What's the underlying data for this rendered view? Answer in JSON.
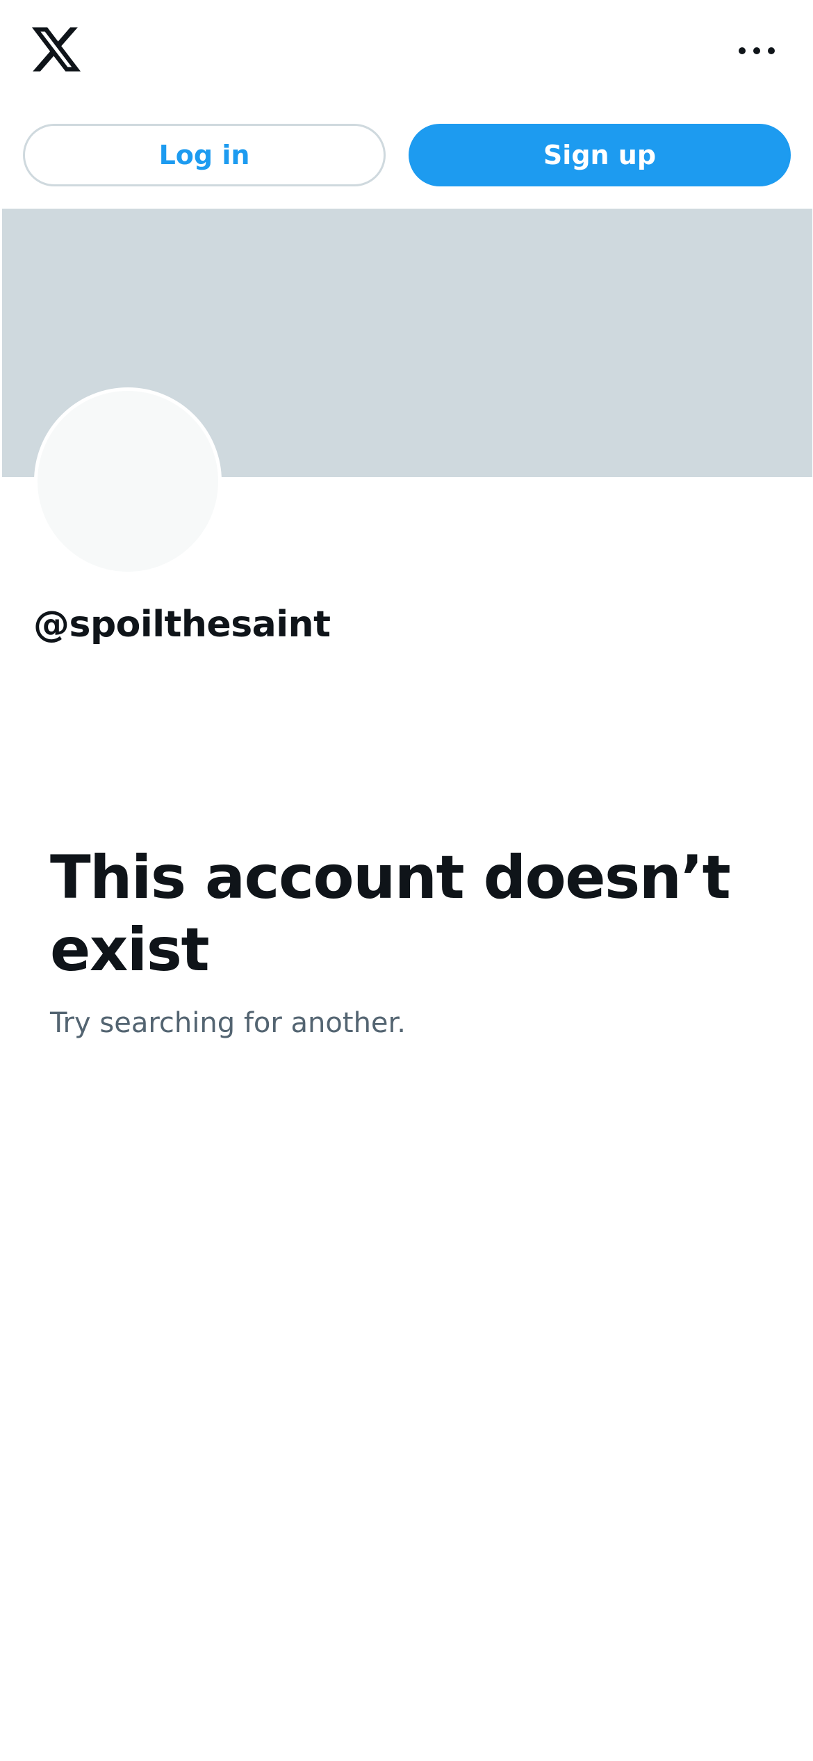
{
  "header": {
    "logo_icon": "x-logo-icon",
    "more_icon": "more-horizontal-icon"
  },
  "auth": {
    "login_label": "Log in",
    "signup_label": "Sign up"
  },
  "profile": {
    "handle": "@spoilthesaint"
  },
  "empty_state": {
    "title": "This account doesn’t exist",
    "subtitle": "Try searching for another."
  },
  "colors": {
    "accent": "#1d9bf0",
    "banner": "#cfd9de",
    "avatar": "#f7f9f9",
    "text_primary": "#0f1419",
    "text_secondary": "#536471",
    "button_border": "#cfd9de"
  }
}
